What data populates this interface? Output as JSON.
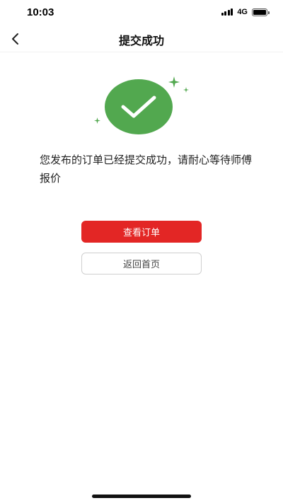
{
  "status_bar": {
    "time": "10:03",
    "network": "4G"
  },
  "nav": {
    "title": "提交成功",
    "back_icon": "chevron-left-icon"
  },
  "result": {
    "icon": "check-circle-icon",
    "icon_color": "#52a84f",
    "message": "您发布的订单已经提交成功，请耐心等待师傅报价"
  },
  "actions": {
    "primary_label": "查看订单",
    "primary_color": "#e32625",
    "secondary_label": "返回首页"
  }
}
